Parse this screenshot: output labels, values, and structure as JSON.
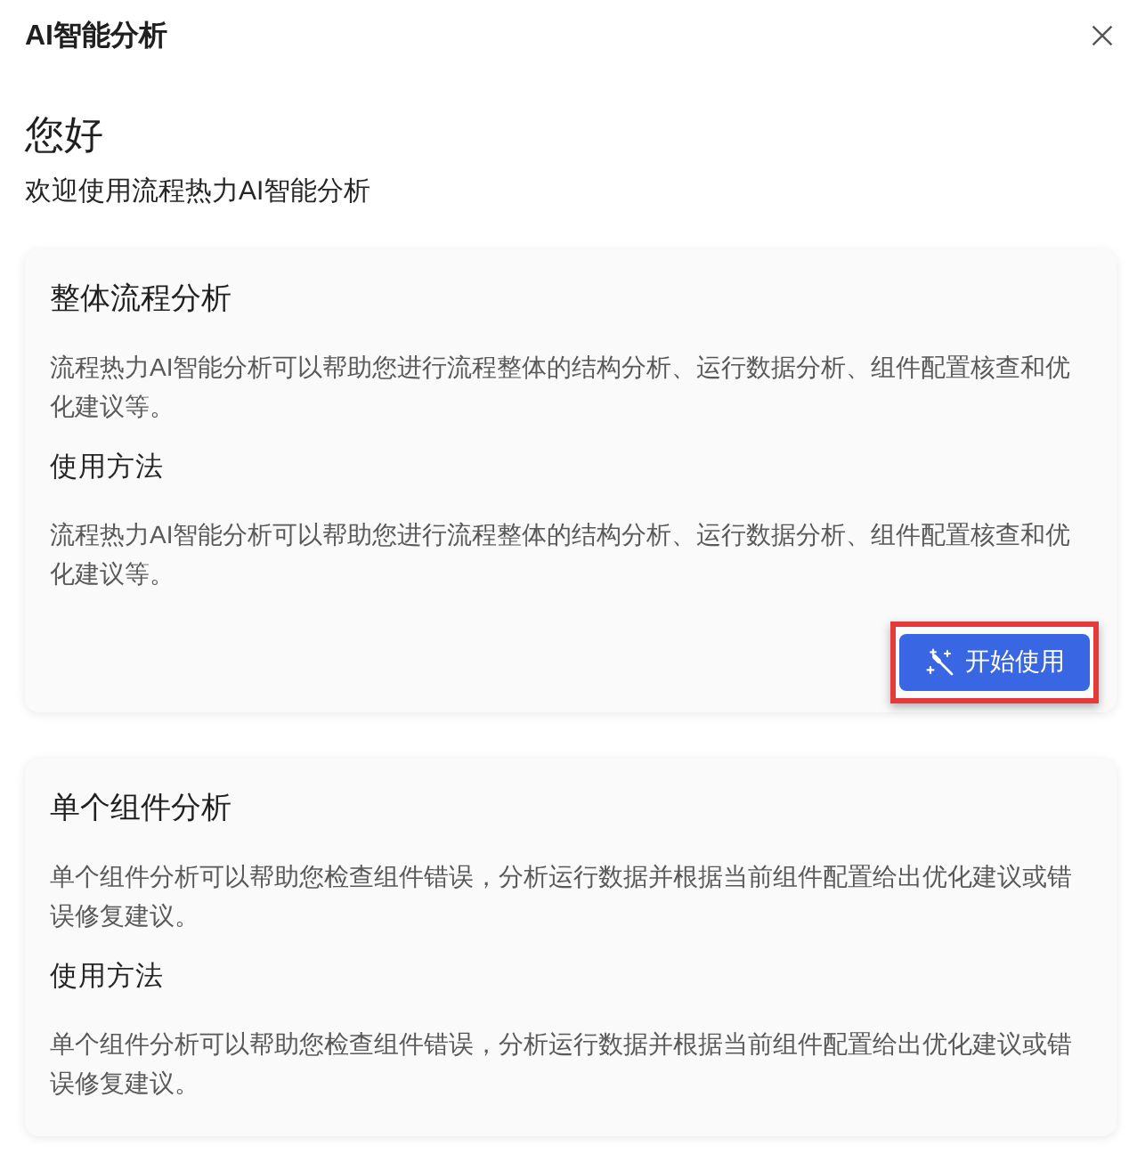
{
  "dialog": {
    "title": "AI智能分析"
  },
  "greeting": {
    "heading": "您好",
    "subtitle": "欢迎使用流程热力AI智能分析"
  },
  "cards": [
    {
      "title": "整体流程分析",
      "description": "流程热力AI智能分析可以帮助您进行流程整体的结构分析、运行数据分析、组件配置核查和优化建议等。",
      "usage_heading": "使用方法",
      "usage_text": "流程热力AI智能分析可以帮助您进行流程整体的结构分析、运行数据分析、组件配置核查和优化建议等。",
      "button": {
        "label": "开始使用",
        "highlighted": true
      }
    },
    {
      "title": "单个组件分析",
      "description": "单个组件分析可以帮助您检查组件错误，分析运行数据并根据当前组件配置给出优化建议或错误修复建议。",
      "usage_heading": "使用方法",
      "usage_text": "单个组件分析可以帮助您检查组件错误，分析运行数据并根据当前组件配置给出优化建议或错误修复建议。"
    }
  ]
}
